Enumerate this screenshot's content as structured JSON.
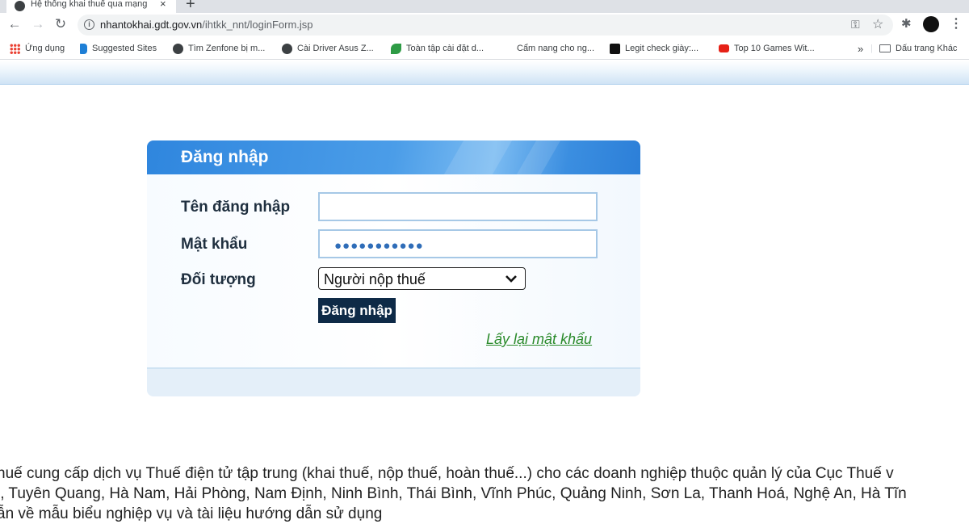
{
  "browser": {
    "tab_title": "Hệ thống khai thuế qua mạng",
    "tab_close": "×",
    "new_tab": "+",
    "url_host": "nhantokhai.gdt.gov.vn",
    "url_path": "/ihtkk_nnt/loginForm.jsp",
    "bookmarks": [
      {
        "label": "Ứng dụng",
        "icon": "apps-grid-icon"
      },
      {
        "label": "Suggested Sites",
        "icon": "bing-icon"
      },
      {
        "label": "Tìm Zenfone bị m...",
        "icon": "globe-icon"
      },
      {
        "label": "Cài Driver Asus Z...",
        "icon": "globe-icon"
      },
      {
        "label": "Toàn tập cài đặt d...",
        "icon": "leaf-icon"
      },
      {
        "label": "Cẩm nang cho ng...",
        "icon": "blank-icon"
      },
      {
        "label": "Legit check giày:...",
        "icon": "nd-logo-icon"
      },
      {
        "label": "Top 10 Games Wit...",
        "icon": "youtube-icon"
      }
    ],
    "bookmarks_overflow": "»",
    "other_bookmarks": "Dấu trang Khác"
  },
  "login": {
    "title": "Đăng nhập",
    "username_label": "Tên đăng nhập",
    "username_value": "",
    "password_label": "Mật khẩu",
    "password_mask": "●●●●●●●●●●●",
    "role_label": "Đối tượng",
    "role_selected": "Người nộp thuế",
    "submit_label": "Đăng nhập",
    "forgot_label": "Lấy lại mật khẩu"
  },
  "intro_lines": [
    "huế cung cấp dịch vụ Thuế điện tử tập trung (khai thuế, nộp thuế, hoàn thuế...) cho các doanh nghiệp thuộc quản lý của Cục Thuế v",
    "i, Tuyên Quang, Hà Nam, Hải Phòng, Nam Định, Ninh Bình, Thái Bình, Vĩnh Phúc, Quảng Ninh, Sơn La, Thanh Hoá, Nghệ An, Hà Tĩn",
    "ẫn về mẫu biểu nghiệp vụ và tài liệu hướng dẫn sử dụng"
  ],
  "colors": {
    "header_blue": "#2f86de",
    "submit_bg": "#0e2a47",
    "forgot_link": "#2a8a2a"
  }
}
